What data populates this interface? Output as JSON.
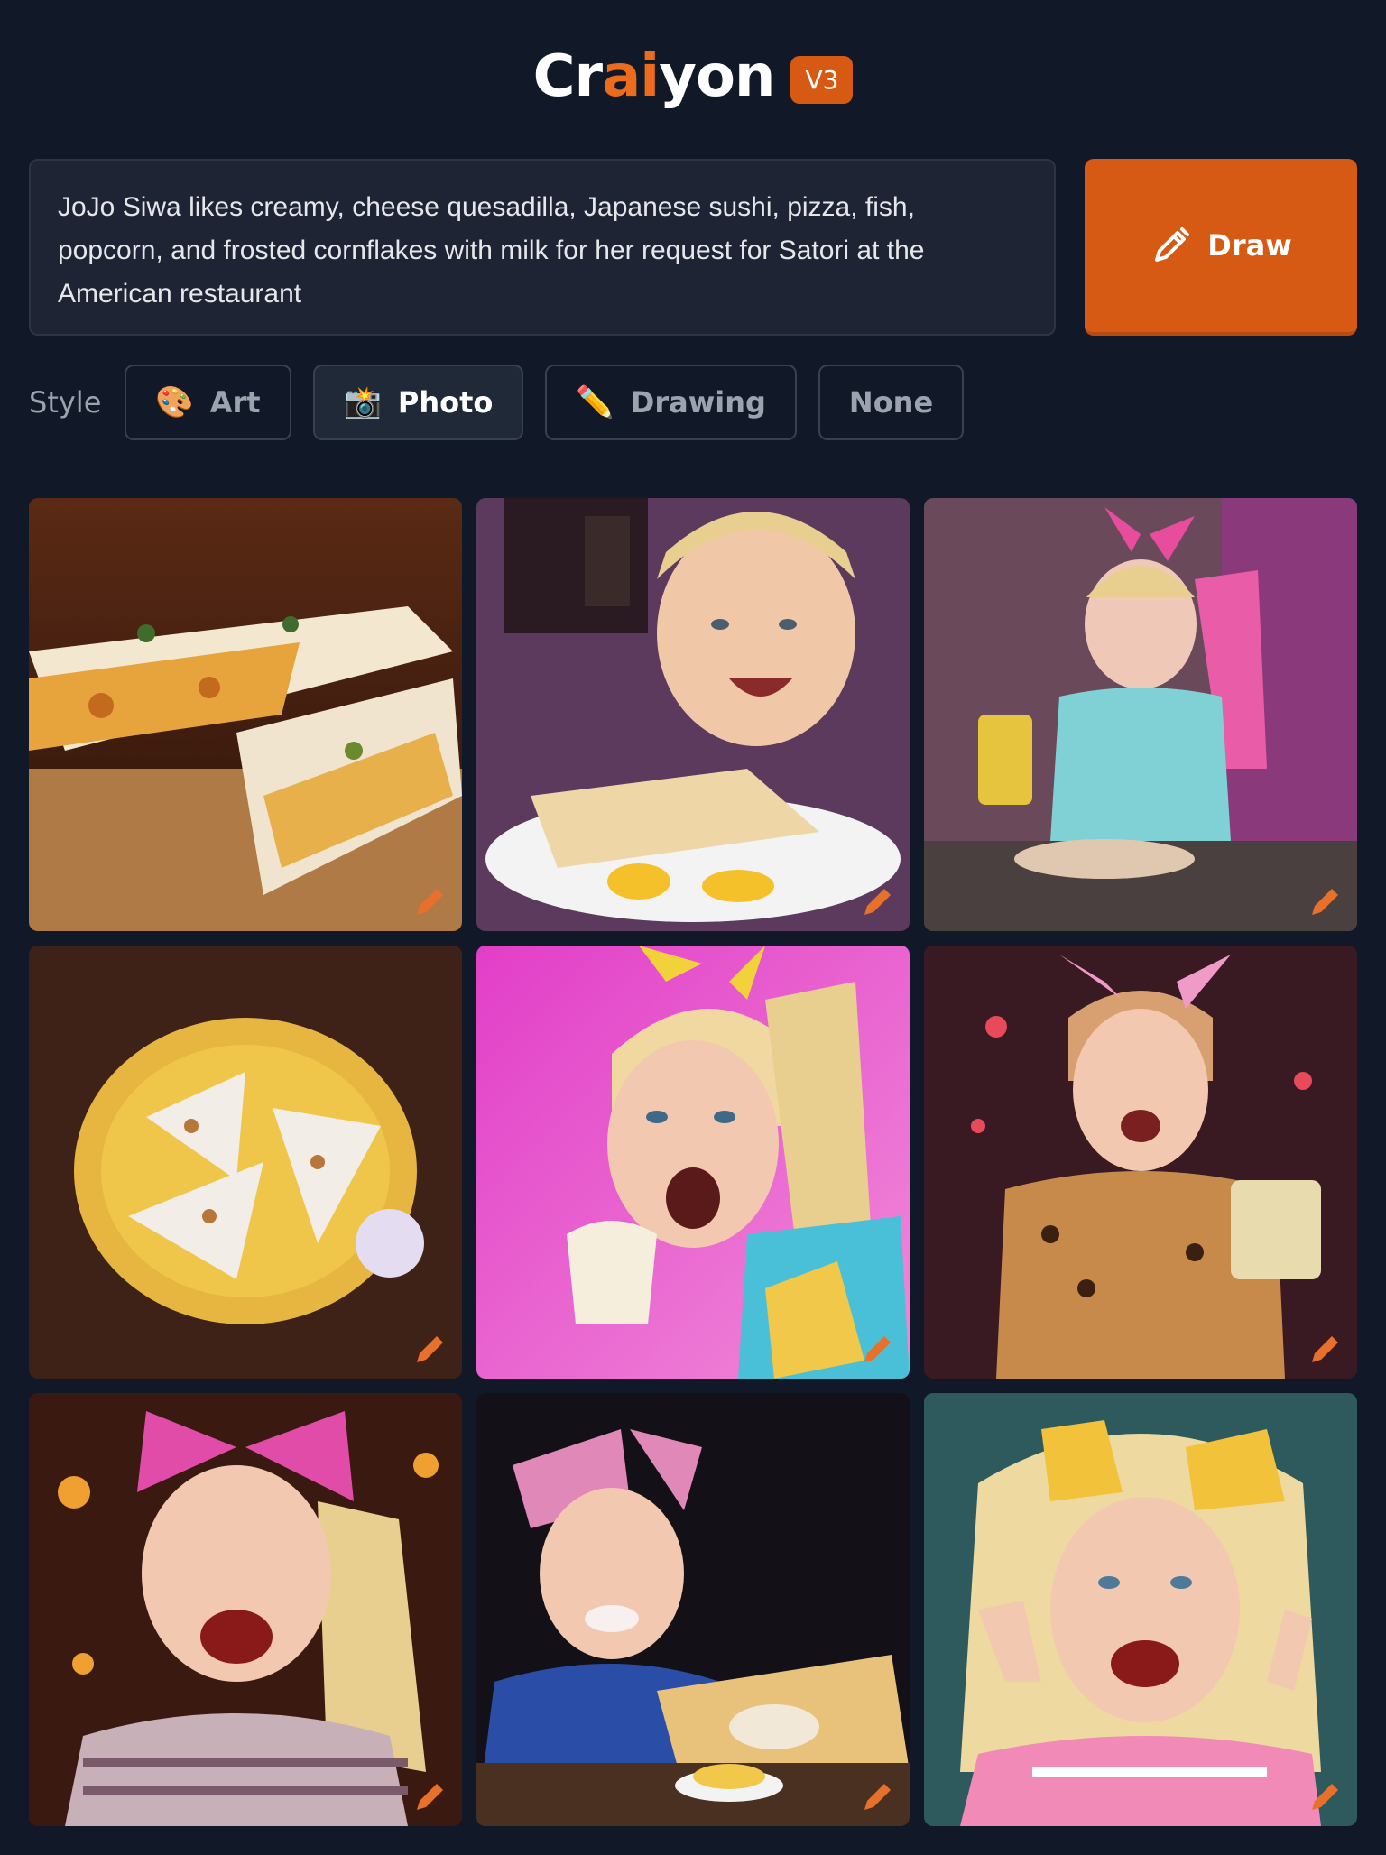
{
  "header": {
    "logo_pre": "Cr",
    "logo_accent": "ai",
    "logo_post": "yon",
    "version": "V3"
  },
  "prompt": {
    "text": "JoJo Siwa likes creamy, cheese quesadilla, Japanese sushi, pizza, fish, popcorn, and frosted cornflakes with milk for her request for Satori at the American restaurant"
  },
  "draw_button": {
    "label": "Draw",
    "icon": "pencil-icon"
  },
  "style": {
    "label": "Style",
    "options": [
      {
        "label": "Art",
        "icon": "🎨",
        "active": false
      },
      {
        "label": "Photo",
        "icon": "📸",
        "active": true
      },
      {
        "label": "Drawing",
        "icon": "✏️",
        "active": false
      },
      {
        "label": "None",
        "icon": "",
        "active": false
      }
    ]
  },
  "colors": {
    "accent": "#d65a14",
    "background": "#111827"
  },
  "results": {
    "count": 9,
    "items": [
      "quesadilla-on-board",
      "girl-with-quesadilla-plate",
      "girl-with-juice",
      "quesadilla-on-yellow-plate",
      "girl-eating-pink-background",
      "girl-holding-drink",
      "girl-pink-bow-laughing",
      "girl-with-food-tray",
      "girl-cheese-bows"
    ]
  }
}
